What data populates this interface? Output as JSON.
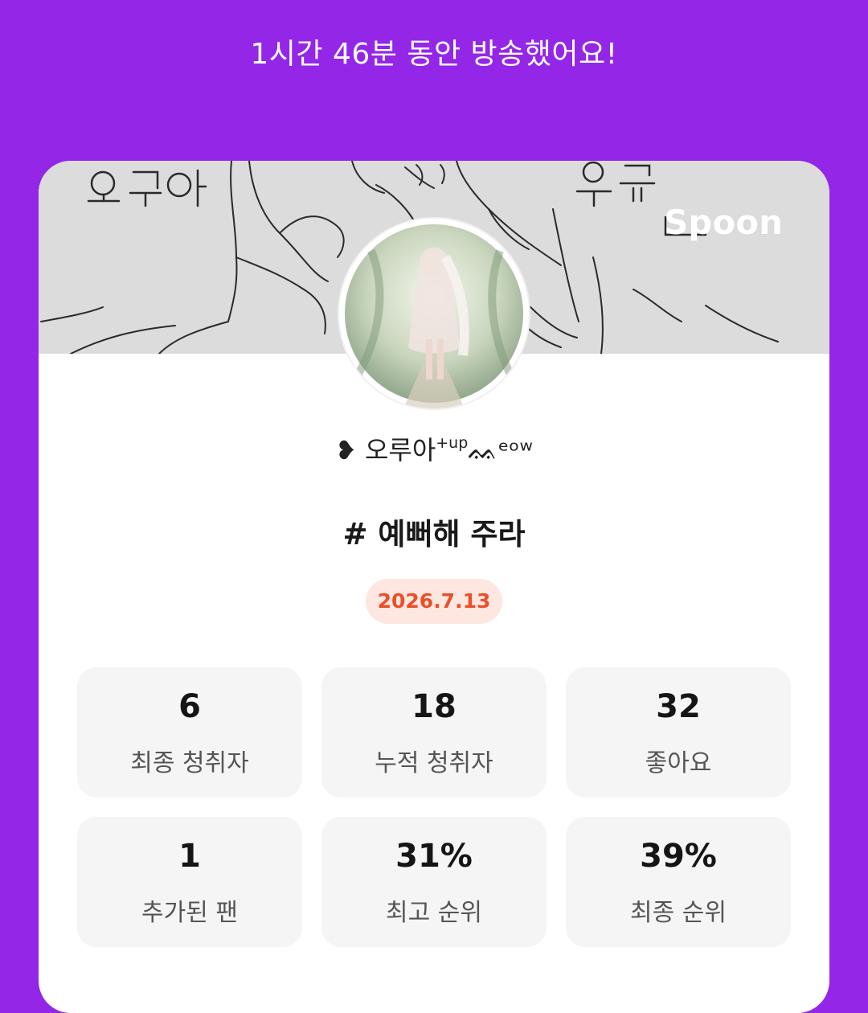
{
  "header": {
    "title": "1시간 46분 동안 방송했어요!"
  },
  "banner": {
    "logo_text": "Spoon",
    "sketch_text_left": "오루아",
    "sketch_text_right": "우현"
  },
  "profile": {
    "nickname_main": "❥ 오루아",
    "nickname_sup": "+up",
    "nickname_tail": "ᨐᵉᵒʷ"
  },
  "broadcast": {
    "title": "# 예뻐해 주라",
    "date": "2026.7.13"
  },
  "stats": [
    {
      "value": "6",
      "label": "최종 청취자"
    },
    {
      "value": "18",
      "label": "누적 청취자"
    },
    {
      "value": "32",
      "label": "좋아요"
    },
    {
      "value": "1",
      "label": "추가된 팬"
    },
    {
      "value": "31%",
      "label": "최고 순위"
    },
    {
      "value": "39%",
      "label": "최종 순위"
    }
  ],
  "colors": {
    "background": "#9426e8",
    "date_text": "#e9502a",
    "date_bg": "#fde7e0",
    "stat_bg": "#f5f5f5"
  }
}
